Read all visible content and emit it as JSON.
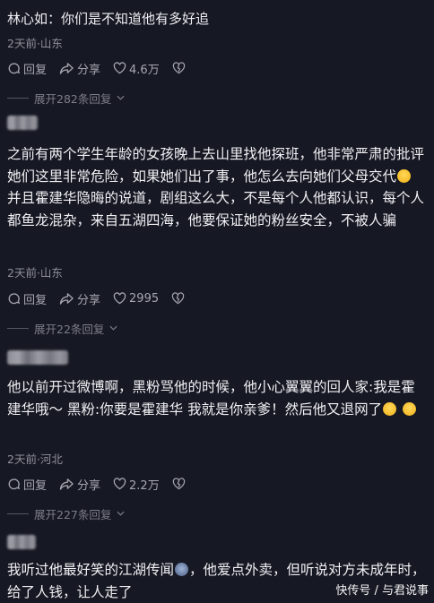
{
  "comments": [
    {
      "author": "林心如：你们是不知道他有多好追",
      "meta": "2天前·山东",
      "reply": "回复",
      "share": "分享",
      "likes": "4.6万",
      "expand": "展开282条回复"
    },
    {
      "author": "",
      "text_part1": "之前有两个学生年龄的女孩晚上去山里找他探班，他非常严肃的批评她们这里非常危险，如果她们出了事，他怎么去向她们父母交代",
      "text_part2": " 并且霍建华隐晦的说道，剧组这么大，不是每个人他都认识，每个人都鱼龙混杂，来自五湖四海，他要保证她的粉丝安全，不被人骗",
      "meta": "2天前·山东",
      "reply": "回复",
      "share": "分享",
      "likes": "2995",
      "expand": "展开22条回复"
    },
    {
      "author": "",
      "text_part1": "他以前开过微博啊，黑粉骂他的时候，他小心翼翼的回人家:我是霍建华哦～ 黑粉:你要是霍建华 我就是你亲爹！然后他又退网了",
      "meta": "2天前·河北",
      "reply": "回复",
      "share": "分享",
      "likes": "2.2万",
      "expand": "展开227条回复"
    },
    {
      "author": "",
      "text_part1": "我听过他最好笑的江湖传闻",
      "text_part2": "，他爱点外卖，但听说对方未成年时，给了人钱，让人走了"
    }
  ],
  "watermark": "快传号 / 与君说事",
  "colors": {
    "background": "#161823",
    "text": "#f1f1f4",
    "meta": "#8f909a"
  },
  "icons": [
    "reply-icon",
    "share-icon",
    "heart-icon",
    "dislike-icon",
    "laugh-emoji-icon",
    "sweat-emoji-icon",
    "cloud-emoji-icon"
  ]
}
